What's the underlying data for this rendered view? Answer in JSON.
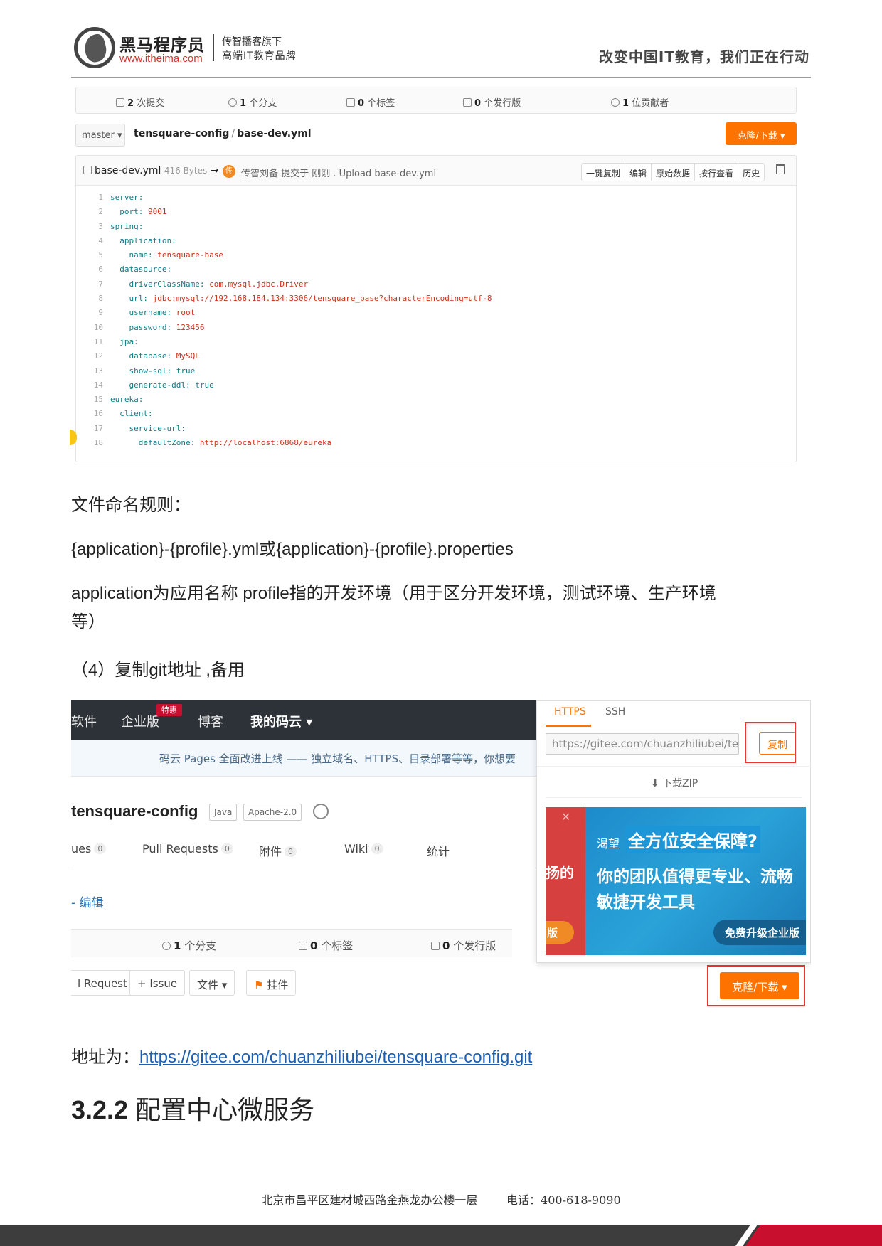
{
  "header": {
    "brand": "黑马程序员",
    "url": "www.itheima.com",
    "sub1": "传智播客旗下",
    "sub2": "高端IT教育品牌",
    "slogan": "改变中国IT教育，我们正在行动"
  },
  "file_view": {
    "stats": [
      {
        "num": "2",
        "label": "次提交"
      },
      {
        "num": "1",
        "label": "个分支"
      },
      {
        "num": "0",
        "label": "个标签"
      },
      {
        "num": "0",
        "label": "个发行版"
      },
      {
        "num": "1",
        "label": "位贡献者"
      }
    ],
    "branch": "master",
    "repo": "tensquare-config",
    "file": "base-dev.yml",
    "clone_label": "克隆/下载",
    "file_header": {
      "name": "base-dev.yml",
      "size": "416 Bytes",
      "arrow": "→",
      "avatar_char": "传",
      "commit": "传智刘备 提交于 刚刚 . Upload base-dev.yml"
    },
    "actions": [
      "一键复制",
      "编辑",
      "原始数据",
      "按行查看",
      "历史"
    ],
    "code_lines": [
      {
        "n": "1",
        "indent": "",
        "key": "server:",
        "val": ""
      },
      {
        "n": "2",
        "indent": "  ",
        "key": "port: ",
        "val": "9001"
      },
      {
        "n": "3",
        "indent": "",
        "key": "spring:",
        "val": ""
      },
      {
        "n": "4",
        "indent": "  ",
        "key": "application:",
        "val": ""
      },
      {
        "n": "5",
        "indent": "    ",
        "key": "name: ",
        "val": "tensquare-base"
      },
      {
        "n": "6",
        "indent": "  ",
        "key": "datasource:",
        "val": ""
      },
      {
        "n": "7",
        "indent": "    ",
        "key": "driverClassName: ",
        "val": "com.mysql.jdbc.Driver"
      },
      {
        "n": "8",
        "indent": "    ",
        "key": "url: ",
        "val": "jdbc:mysql://192.168.184.134:3306/tensquare_base?characterEncoding=utf-8"
      },
      {
        "n": "9",
        "indent": "    ",
        "key": "username: ",
        "val": "root"
      },
      {
        "n": "10",
        "indent": "    ",
        "key": "password: ",
        "val": "123456"
      },
      {
        "n": "11",
        "indent": "  ",
        "key": "jpa:",
        "val": ""
      },
      {
        "n": "12",
        "indent": "    ",
        "key": "database: ",
        "val": "MySQL"
      },
      {
        "n": "13",
        "indent": "    ",
        "key": "show-sql: ",
        "val": "true"
      },
      {
        "n": "14",
        "indent": "    ",
        "key": "generate-ddl: ",
        "val": "true"
      },
      {
        "n": "15",
        "indent": "",
        "key": "eureka:",
        "val": ""
      },
      {
        "n": "16",
        "indent": "  ",
        "key": "client:",
        "val": ""
      },
      {
        "n": "17",
        "indent": "    ",
        "key": "service-url:",
        "val": ""
      },
      {
        "n": "18",
        "indent": "      ",
        "key": "defaultZone: ",
        "val": "http://localhost:6868/eureka"
      }
    ]
  },
  "text": {
    "p1": "文件命名规则：",
    "p2": "{application}-{profile}.yml或{application}-{profile}.properties",
    "p3a": "application为应用名称 profile指的开发环境（用于区分开发环境，测试环境、生产环境",
    "p3b": "等）",
    "p4": "（4）复制git地址 ,备用",
    "p5_prefix": "地址为：",
    "p5_link": "https://gitee.com/chuanzhiliubei/tensquare-config.git",
    "h_num": "3.2.2",
    "h_title": " 配置中心微服务"
  },
  "repo_view": {
    "nav": [
      "软件",
      "企业版",
      "博客",
      "我的码云 ▾"
    ],
    "hot": "特惠",
    "notice": "码云 Pages 全面改进上线 —— 独立域名、HTTPS、目录部署等等，你想要",
    "repo_title": "tensquare-config",
    "tags": [
      "Java",
      "Apache-2.0"
    ],
    "tabs": [
      {
        "label": "ues",
        "count": "0"
      },
      {
        "label": "Pull Requests",
        "count": "0"
      },
      {
        "label": "附件",
        "count": "0"
      },
      {
        "label": "Wiki",
        "count": "0"
      },
      {
        "label": "统计",
        "count": ""
      }
    ],
    "edit": "- 编辑",
    "stats": [
      {
        "num": "1",
        "label": "个分支"
      },
      {
        "num": "0",
        "label": "个标签"
      },
      {
        "num": "0",
        "label": "个发行版"
      }
    ],
    "buttons": [
      "l Request",
      "+ Issue",
      "文件 ▾",
      "挂件"
    ],
    "clone_label": "克隆/下载 ▾",
    "popover": {
      "tab_https": "HTTPS",
      "tab_ssh": "SSH",
      "url": "https://gitee.com/chuanzhiliubei/tensquare-config.git",
      "copy": "复制",
      "zip": "下载ZIP",
      "ad": {
        "left1": "扬的",
        "left2": "版",
        "kicker": "渴望",
        "headline": "全方位安全保障?",
        "line2": "你的团队值得更专业、流畅",
        "line3": "敏捷开发工具",
        "cta": "免费升级企业版"
      }
    }
  },
  "footer": {
    "address": "北京市昌平区建材城西路金燕龙办公楼一层",
    "phone": "电话：400-618-9090"
  }
}
